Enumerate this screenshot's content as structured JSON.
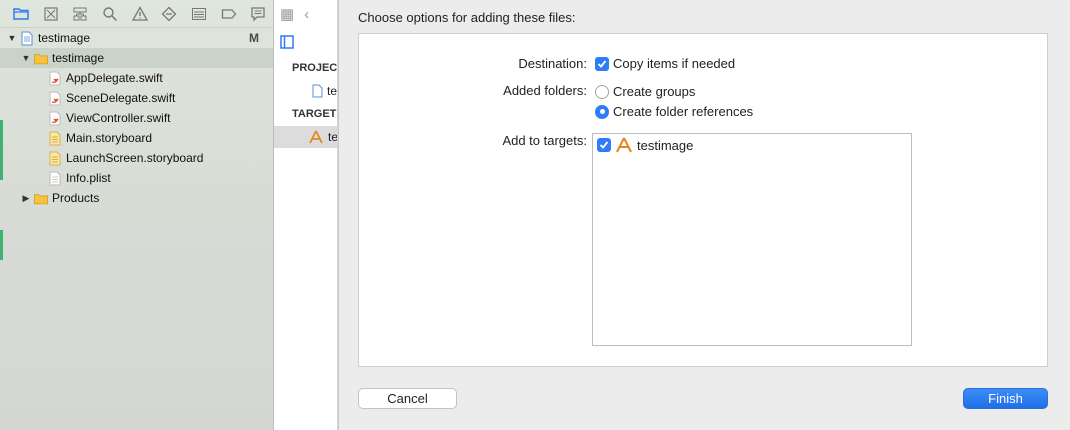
{
  "navigator": {
    "project_name": "testimage",
    "project_status": "M",
    "group_name": "testimage",
    "files": [
      {
        "name": "AppDelegate.swift",
        "kind": "swift"
      },
      {
        "name": "SceneDelegate.swift",
        "kind": "swift"
      },
      {
        "name": "ViewController.swift",
        "kind": "swift"
      },
      {
        "name": "Main.storyboard",
        "kind": "storyboard"
      },
      {
        "name": "LaunchScreen.storyboard",
        "kind": "storyboard"
      },
      {
        "name": "Info.plist",
        "kind": "plist"
      }
    ],
    "products_label": "Products",
    "toolbar_icons": [
      "folder-icon",
      "source-control-icon",
      "hierarchy-icon",
      "search-icon",
      "warning-icon",
      "test-icon",
      "debug-icon",
      "breakpoint-icon",
      "report-icon"
    ]
  },
  "middle": {
    "project_section": "PROJECT",
    "project_item": "testimage",
    "targets_section": "TARGETS",
    "target_item": "testimage"
  },
  "sheet": {
    "title": "Choose options for adding these files:",
    "destination_label": "Destination:",
    "copy_items_label": "Copy items if needed",
    "added_folders_label": "Added folders:",
    "create_groups_label": "Create groups",
    "create_folder_refs_label": "Create folder references",
    "add_to_targets_label": "Add to targets:",
    "target_name": "testimage",
    "cancel_label": "Cancel",
    "finish_label": "Finish"
  },
  "colors": {
    "accent": "#2f7cf6",
    "folder": "#f5c242"
  }
}
